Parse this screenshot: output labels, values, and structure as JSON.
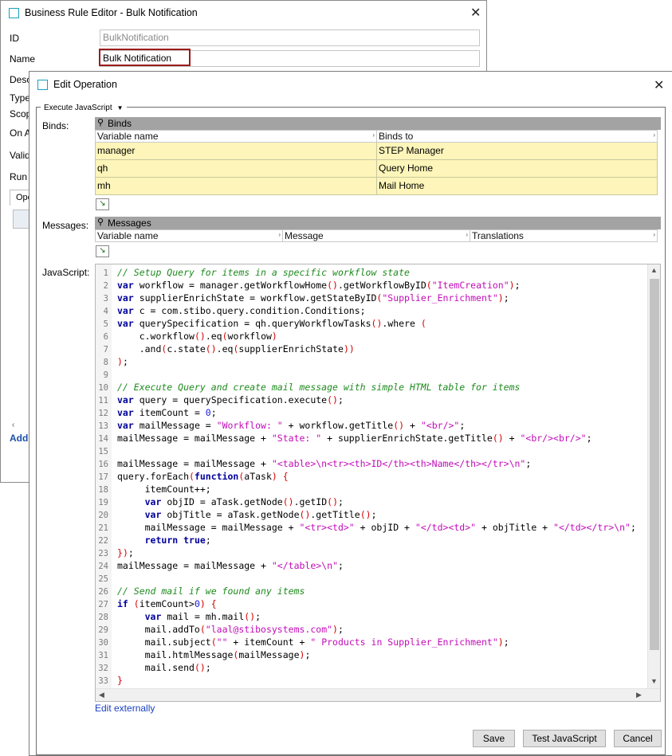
{
  "bg_window": {
    "title": "Business Rule Editor - Bulk Notification",
    "labels": {
      "id": "ID",
      "name": "Name",
      "desc": "Desc",
      "type": "Type",
      "scope": "Scop",
      "on": "On A",
      "valid": "Valid",
      "run": "Run"
    },
    "id_value": "BulkNotification",
    "name_value": "Bulk Notification",
    "tab_label": "Ope",
    "add_link": "Add"
  },
  "dialog": {
    "title": "Edit Operation",
    "operation_type": "Execute JavaScript",
    "binds_label": "Binds:",
    "binds_title": "Binds",
    "binds_columns": [
      "Variable name",
      "Binds to"
    ],
    "binds_rows": [
      [
        "manager",
        "STEP Manager"
      ],
      [
        "qh",
        "Query Home"
      ],
      [
        "mh",
        "Mail Home"
      ]
    ],
    "messages_label": "Messages:",
    "messages_title": "Messages",
    "messages_columns": [
      "Variable name",
      "Message",
      "Translations"
    ],
    "javascript_label": "JavaScript:",
    "edit_externally": "Edit externally",
    "buttons": {
      "save": "Save",
      "test": "Test JavaScript",
      "cancel": "Cancel"
    }
  },
  "code_lines": [
    "// Setup Query for items in a specific workflow state",
    "var workflow = manager.getWorkflowHome().getWorkflowByID(\"ItemCreation\");",
    "var supplierEnrichState = workflow.getStateByID(\"Supplier_Enrichment\");",
    "var c = com.stibo.query.condition.Conditions;",
    "var querySpecification = qh.queryWorkflowTasks().where (",
    "    c.workflow().eq(workflow)",
    "    .and(c.state().eq(supplierEnrichState))",
    ");",
    "",
    "// Execute Query and create mail message with simple HTML table for items",
    "var query = querySpecification.execute();",
    "var itemCount = 0;",
    "var mailMessage = \"Workflow: \" + workflow.getTitle() + \"<br/>\";",
    "mailMessage = mailMessage + \"State: \" + supplierEnrichState.getTitle() + \"<br/><br/>\";",
    "",
    "mailMessage = mailMessage + \"<table>\\n<tr><th>ID</th><th>Name</th></tr>\\n\";",
    "query.forEach(function(aTask) {",
    "     itemCount++;",
    "     var objID = aTask.getNode().getID();",
    "     var objTitle = aTask.getNode().getTitle();",
    "     mailMessage = mailMessage + \"<tr><td>\" + objID + \"</td><td>\" + objTitle + \"</td></tr>\\n\";",
    "     return true;",
    "});",
    "mailMessage = mailMessage + \"</table>\\n\";",
    "",
    "// Send mail if we found any items",
    "if (itemCount>0) {",
    "     var mail = mh.mail();",
    "     mail.addTo(\"laal@stibosystems.com\");",
    "     mail.subject(\"\" + itemCount + \" Products in Supplier_Enrichment\");",
    "     mail.htmlMessage(mailMessage);",
    "     mail.send();",
    "}"
  ],
  "colors": {
    "row_fill": "#fdf5b9",
    "keyword": "#00009c",
    "string": "#c20cb9",
    "comment": "#1e8a1e",
    "name_highlight": "#9b1b1b"
  },
  "icons": [
    "window-icon",
    "close-icon",
    "pin-icon",
    "add-row-icon",
    "dropdown-arrow-icon",
    "sort-arrow-icon"
  ]
}
